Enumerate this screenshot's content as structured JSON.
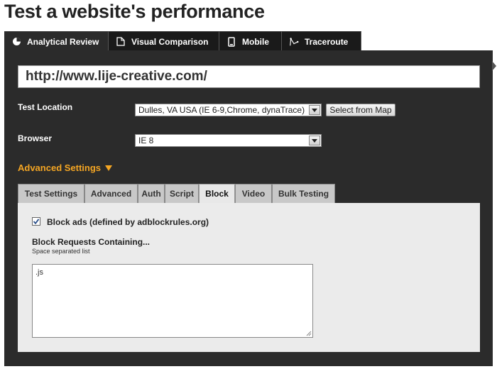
{
  "page": {
    "title": "Test a website's performance"
  },
  "main_tabs": [
    {
      "label": "Analytical Review",
      "icon": "chart-icon",
      "active": true
    },
    {
      "label": "Visual Comparison",
      "icon": "document-icon",
      "active": false
    },
    {
      "label": "Mobile",
      "icon": "mobile-icon",
      "active": false
    },
    {
      "label": "Traceroute",
      "icon": "traceroute-icon",
      "active": false
    }
  ],
  "form": {
    "url_value": "http://www.lije-creative.com/",
    "test_location_label": "Test Location",
    "test_location_value": "Dulles, VA USA (IE 6-9,Chrome, dynaTrace)",
    "select_from_map_label": "Select from Map",
    "browser_label": "Browser",
    "browser_value": "IE 8",
    "advanced_settings_label": "Advanced Settings"
  },
  "sub_tabs": [
    {
      "label": "Test Settings",
      "active": false
    },
    {
      "label": "Advanced",
      "active": false
    },
    {
      "label": "Auth",
      "active": false
    },
    {
      "label": "Script",
      "active": false
    },
    {
      "label": "Block",
      "active": true
    },
    {
      "label": "Video",
      "active": false
    },
    {
      "label": "Bulk Testing",
      "active": false
    }
  ],
  "block": {
    "block_ads_label": "Block ads (defined by adblockrules.org)",
    "block_ads_checked": true,
    "block_requests_title": "Block Requests Containing...",
    "block_requests_hint": "Space separated list",
    "block_requests_value": ".js"
  },
  "colors": {
    "panel_bg": "#2b2b2b",
    "accent": "#f5a623",
    "subpanel_bg": "#ebebeb"
  }
}
